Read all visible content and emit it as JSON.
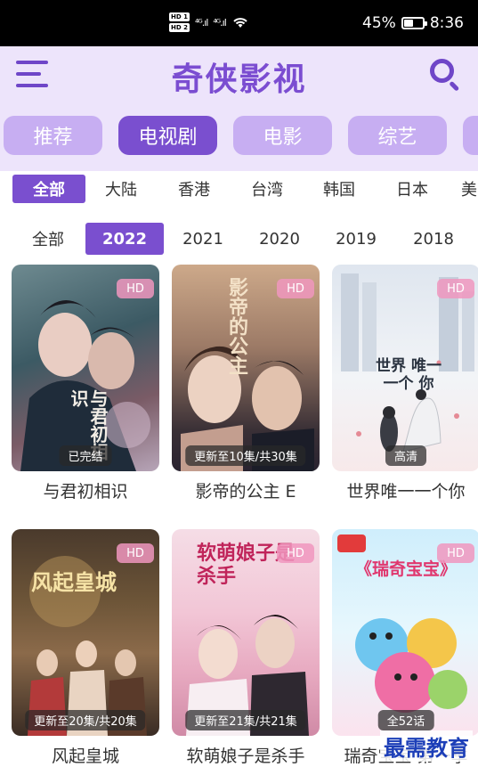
{
  "status_bar": {
    "hd1": "HD 1",
    "hd2": "HD 2",
    "signal1": "⁴ᴳ.ıl",
    "signal2": "⁴ᴳ.ıl",
    "battery": "45%",
    "time": "8:36"
  },
  "header": {
    "title": "奇侠影视",
    "tabs": [
      {
        "label": "推荐"
      },
      {
        "label": "电视剧"
      },
      {
        "label": "电影"
      },
      {
        "label": "综艺"
      }
    ]
  },
  "region_filter": [
    "全部",
    "大陆",
    "香港",
    "台湾",
    "韩国",
    "日本",
    "美"
  ],
  "year_filter": [
    "全部",
    "2022",
    "2021",
    "2020",
    "2019",
    "2018"
  ],
  "cards": [
    {
      "title": "与君初相识",
      "badge": "HD",
      "status": "已完结",
      "art_text": "与君初相识"
    },
    {
      "title": "影帝的公主 E",
      "badge": "HD",
      "status": "更新至10集/共30集",
      "art_text": "影帝的公主"
    },
    {
      "title": "世界唯一一个你",
      "badge": "HD",
      "status": "高清",
      "art_text": "世界 唯一 一个 你"
    },
    {
      "title": "风起皇城",
      "badge": "HD",
      "status": "更新至20集/共20集",
      "art_text": "风起皇城"
    },
    {
      "title": "软萌娘子是杀手",
      "badge": "HD",
      "status": "更新至21集/共21集",
      "art_text": "软萌娘子是杀手"
    },
    {
      "title": "瑞奇宝宝 第一季",
      "badge": "HD",
      "status": "全52话",
      "art_text": "《瑞奇宝宝》"
    }
  ],
  "watermark": "最需教育",
  "colors": {
    "accent": "#7a4fcf",
    "tab_inactive": "#c7aef2",
    "header_bg": "#ede4fb"
  }
}
